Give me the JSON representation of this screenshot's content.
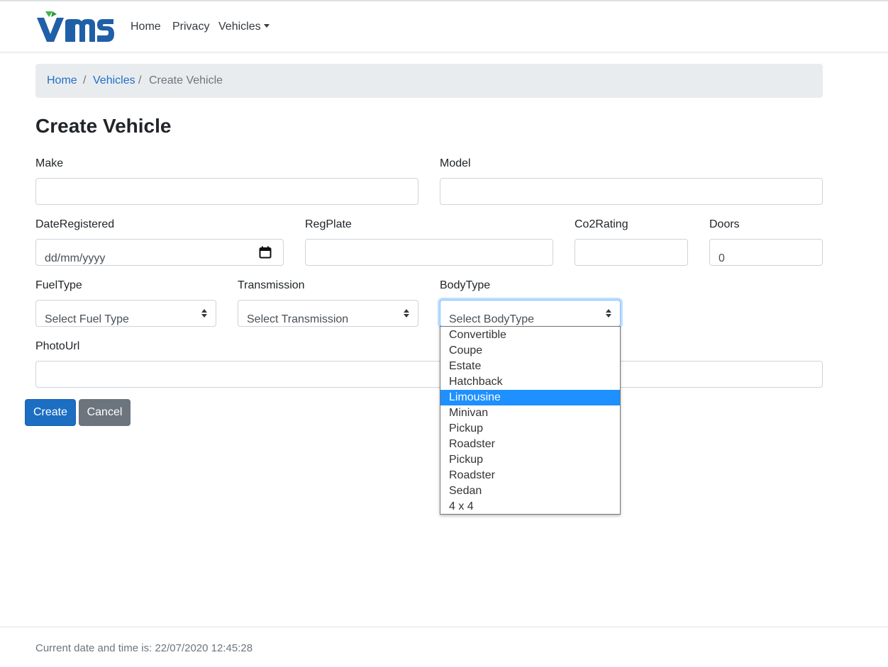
{
  "brand": {
    "logo_text": "VMS",
    "colors": {
      "primary": "#1f5fa8",
      "accent": "#3cb44b"
    }
  },
  "nav": {
    "home": "Home",
    "privacy": "Privacy",
    "vehicles": "Vehicles"
  },
  "breadcrumb": {
    "home": "Home",
    "vehicles": "Vehicles",
    "current": "Create Vehicle",
    "separator": "/"
  },
  "page": {
    "title": "Create Vehicle"
  },
  "form": {
    "make": {
      "label": "Make",
      "value": ""
    },
    "model": {
      "label": "Model",
      "value": ""
    },
    "date_registered": {
      "label": "DateRegistered",
      "placeholder": "dd/mm/yyyy"
    },
    "reg_plate": {
      "label": "RegPlate",
      "value": ""
    },
    "co2_rating": {
      "label": "Co2Rating",
      "value": ""
    },
    "doors": {
      "label": "Doors",
      "value": "0"
    },
    "fuel_type": {
      "label": "FuelType",
      "selected": "Select Fuel Type"
    },
    "transmission": {
      "label": "Transmission",
      "selected": "Select Transmission"
    },
    "body_type": {
      "label": "BodyType",
      "selected": "Select BodyType",
      "open": true,
      "highlighted": "Limousine",
      "options": [
        "Convertible",
        "Coupe",
        "Estate",
        "Hatchback",
        "Limousine",
        "Minivan",
        "Pickup",
        "Roadster",
        "Pickup",
        "Roadster",
        "Sedan",
        "4 x 4"
      ]
    },
    "photo_url": {
      "label": "PhotoUrl",
      "value": ""
    }
  },
  "buttons": {
    "create": "Create",
    "cancel": "Cancel"
  },
  "footer": {
    "text": "Current date and time is: 22/07/2020 12:45:28"
  }
}
